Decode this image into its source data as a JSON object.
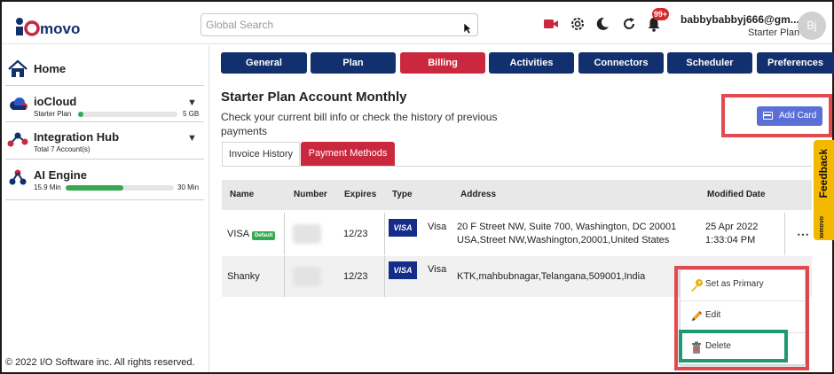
{
  "header": {
    "logo_text": "iomovo",
    "search_placeholder": "Global Search",
    "notification_count": "99+",
    "user_email": "babbybabbyj666@gm...",
    "user_plan": "Starter Plan",
    "avatar_initials": "Bj"
  },
  "sidebar": {
    "home": "Home",
    "items": [
      {
        "title": "ioCloud",
        "sub": "Starter Plan",
        "bar_fraction": 0.05,
        "bar_value": "5 GB"
      },
      {
        "title": "Integration Hub",
        "sub": "Total 7 Account(s)"
      },
      {
        "title": "AI Engine",
        "sub": "15.9 Min",
        "bar_fraction": 0.53,
        "bar_value": "30 Min"
      }
    ],
    "copyright": "© 2022 I/O Software inc. All rights reserved."
  },
  "tabs": [
    {
      "label": "General"
    },
    {
      "label": "Plan"
    },
    {
      "label": "Billing",
      "active": true
    },
    {
      "label": "Activities"
    },
    {
      "label": "Connectors"
    },
    {
      "label": "Scheduler"
    },
    {
      "label": "Preferences"
    }
  ],
  "page": {
    "title": "Starter Plan Account Monthly",
    "description": "Check your current bill info or check the history of previous payments",
    "add_card_label": "Add Card",
    "feedback_label": "Feedback",
    "feedback_logo": "iomovo"
  },
  "subtabs": {
    "invoice_history": "Invoice History",
    "payment_methods": "Payment Methods"
  },
  "table": {
    "headers": {
      "name": "Name",
      "number": "Number",
      "expires": "Expires",
      "type": "Type",
      "address": "Address",
      "modified": "Modified Date"
    },
    "rows": [
      {
        "name": "VISA",
        "badge": "Default",
        "expires": "12/23",
        "card_logo": "VISA",
        "type": "Visa",
        "address_line1": "20 F Street NW, Suite 700, Washington, DC 20001",
        "address_line2": "USA,Street NW,Washington,20001,United States",
        "modified_line1": "25 Apr 2022",
        "modified_line2": "1:33:04 PM"
      },
      {
        "name": "Shanky",
        "expires": "12/23",
        "card_logo": "VISA",
        "type": "Visa",
        "address_line1": "KTK,mahbubnagar,Telangana,509001,India"
      }
    ]
  },
  "context_menu": {
    "set_primary": "Set as Primary",
    "edit": "Edit",
    "delete": "Delete"
  },
  "colors": {
    "nav_blue": "#12306e",
    "active_red": "#c9283e",
    "highlight_red": "#e24a4f",
    "highlight_green": "#1f9a6e",
    "button_blue": "#5b6fd6",
    "progress_green": "#35a852",
    "feedback_yellow": "#f5b800"
  }
}
